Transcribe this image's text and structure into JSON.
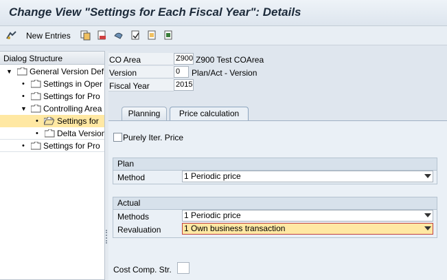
{
  "window": {
    "title": "Change View \"Settings for Each Fiscal Year\": Details"
  },
  "toolbar": {
    "new_entries_label": "New Entries",
    "icons": [
      "glasses-icon",
      "copy-icon",
      "delete-icon",
      "undo-icon",
      "select-all-icon",
      "select-block-icon",
      "deselect-all-icon"
    ]
  },
  "dialog_structure": {
    "header": "Dialog Structure",
    "items": [
      {
        "label": "General Version Def"
      },
      {
        "label": "Settings in Oper"
      },
      {
        "label": "Settings for Pro"
      },
      {
        "label": "Controlling Area"
      },
      {
        "label": "Settings for"
      },
      {
        "label": "Delta Version"
      },
      {
        "label": "Settings for Pro"
      }
    ]
  },
  "header_fields": {
    "co_area": {
      "label": "CO Area",
      "value": "Z900",
      "text": "Z900 Test COArea"
    },
    "version": {
      "label": "Version",
      "value": "0",
      "text": "Plan/Act - Version"
    },
    "fiscal_year": {
      "label": "Fiscal Year",
      "value": "2015"
    }
  },
  "tabs": [
    {
      "label": "Planning"
    },
    {
      "label": "Price calculation"
    }
  ],
  "price_calc": {
    "purely_iter_price_label": "Purely Iter. Price",
    "plan": {
      "title": "Plan",
      "method_label": "Method",
      "method_value": "1 Periodic price"
    },
    "actual": {
      "title": "Actual",
      "methods_label": "Methods",
      "methods_value": "1 Periodic price",
      "revaluation_label": "Revaluation",
      "revaluation_value": "1 Own business transaction"
    },
    "cost_comp_label": "Cost Comp. Str."
  },
  "colors": {
    "selected_row": "#ffe8a3",
    "title_text": "#1c2a3a",
    "background": "#dfe6ee"
  }
}
